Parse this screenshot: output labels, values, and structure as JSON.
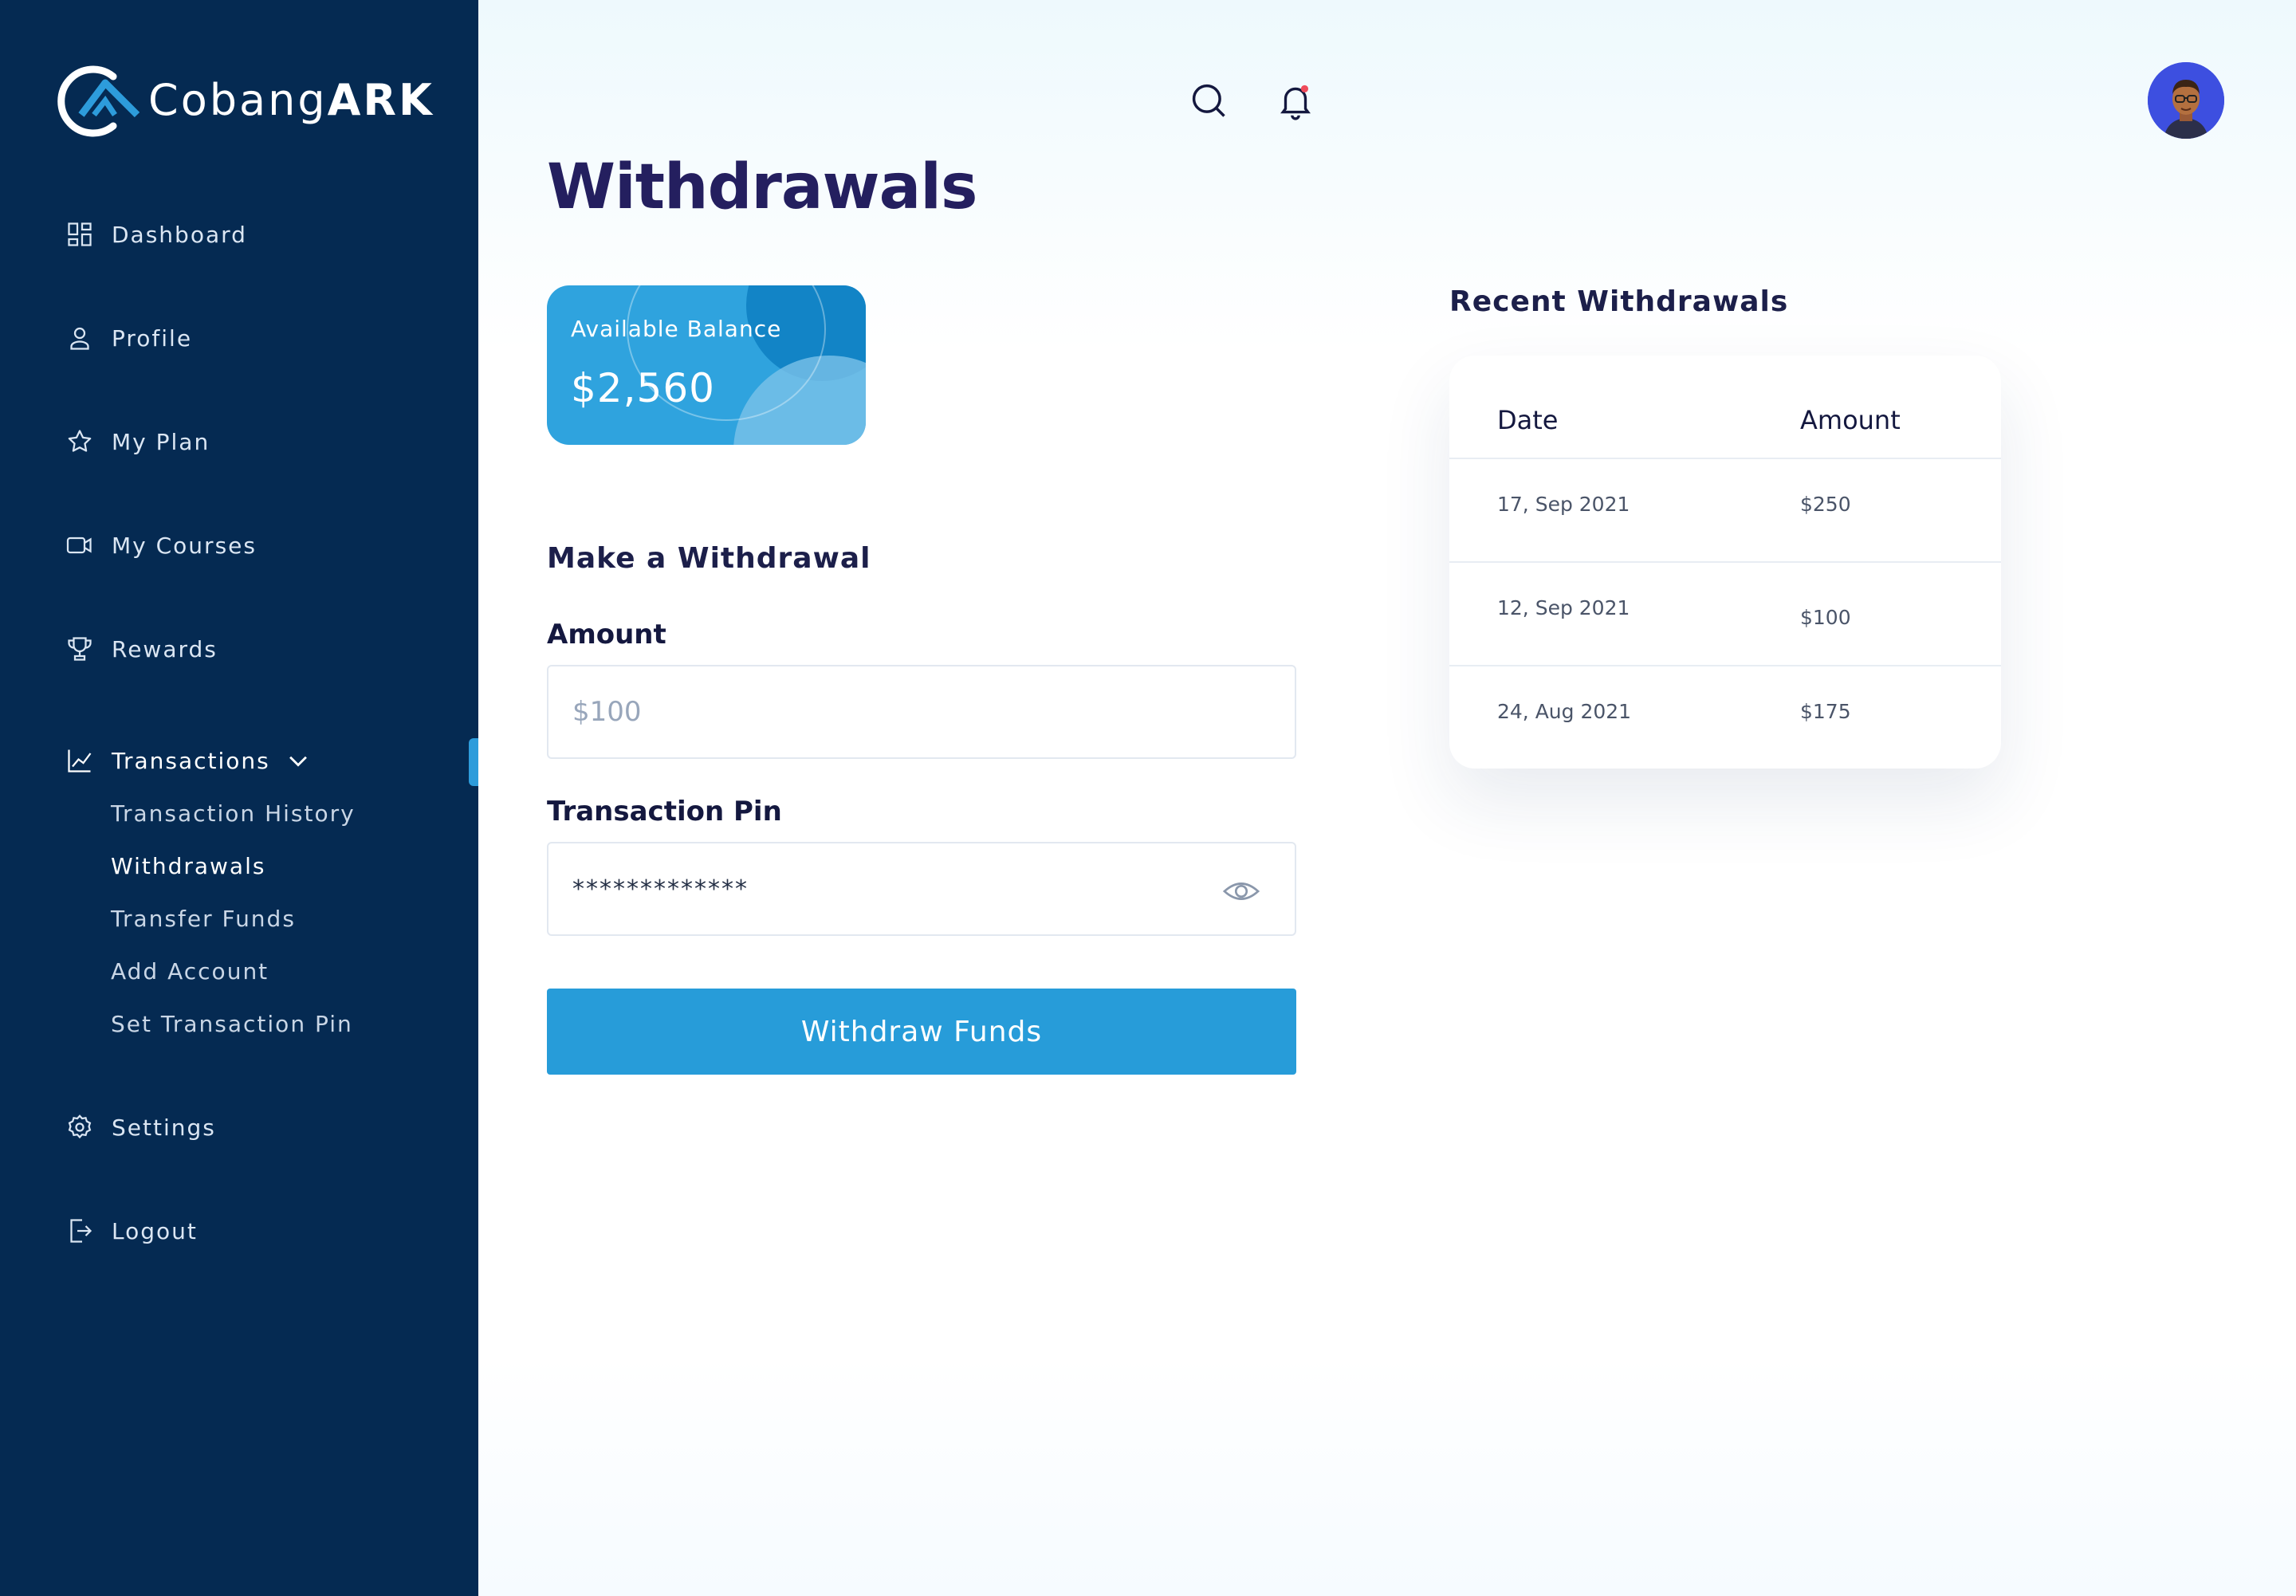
{
  "brand": {
    "name_light": "Cobang",
    "name_bold": "ARK",
    "accent": "#2d9cdb"
  },
  "sidebar": {
    "items": [
      {
        "label": "Dashboard",
        "icon": "dashboard-icon"
      },
      {
        "label": "Profile",
        "icon": "user-icon"
      },
      {
        "label": "My Plan",
        "icon": "star-icon"
      },
      {
        "label": "My Courses",
        "icon": "video-icon"
      },
      {
        "label": "Rewards",
        "icon": "trophy-icon"
      },
      {
        "label": "Transactions",
        "icon": "chart-line-icon"
      },
      {
        "label": "Settings",
        "icon": "gear-icon"
      },
      {
        "label": "Logout",
        "icon": "logout-icon"
      }
    ],
    "transactions_sub": [
      {
        "label": "Transaction History"
      },
      {
        "label": "Withdrawals"
      },
      {
        "label": "Transfer Funds"
      },
      {
        "label": "Add Account"
      },
      {
        "label": "Set Transaction Pin"
      }
    ]
  },
  "header": {
    "title": "Withdrawals"
  },
  "balance": {
    "label": "Available Balance",
    "value": "$2,560"
  },
  "withdraw_form": {
    "title": "Make a Withdrawal",
    "amount_label": "Amount",
    "amount_placeholder": "$100",
    "pin_label": "Transaction Pin",
    "pin_value": "*************",
    "submit_label": "Withdraw Funds"
  },
  "recent": {
    "title": "Recent Withdrawals",
    "columns": [
      "Date",
      "Amount"
    ],
    "rows": [
      {
        "date": "17, Sep 2021",
        "amount": "$250"
      },
      {
        "date": "12, Sep 2021",
        "amount": "$100"
      },
      {
        "date": "24, Aug 2021",
        "amount": "$175"
      }
    ]
  }
}
